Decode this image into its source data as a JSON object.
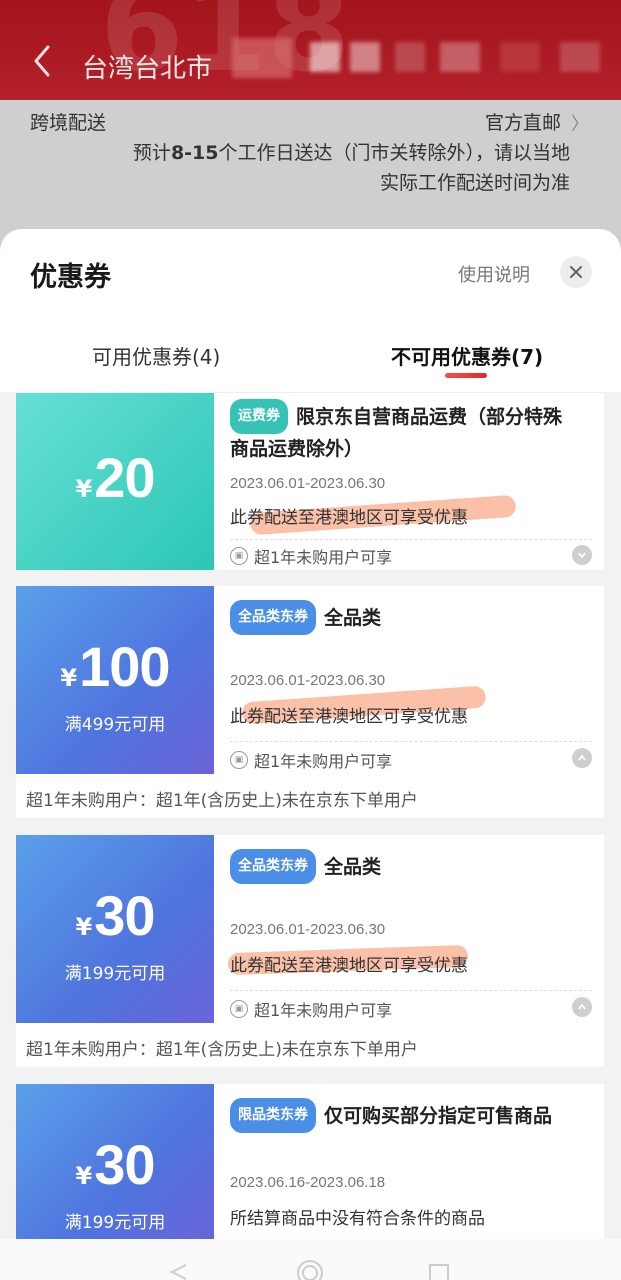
{
  "header": {
    "location": "台湾台北市"
  },
  "shipping": {
    "label": "跨境配送",
    "official": "官方直邮",
    "desc_prefix": "预计",
    "desc_days": "8-15",
    "desc_suffix": "个工作日送达（门市关转除外），请以当地实际工作配送时间为准"
  },
  "sheet": {
    "title": "优惠券",
    "help": "使用说明",
    "tabs": {
      "available": "可用优惠券(4)",
      "unavailable": "不可用优惠券(7)"
    }
  },
  "coupons": [
    {
      "color": "teal",
      "currency": "¥",
      "amount": "20",
      "threshold": "",
      "badge": "运费券",
      "title": "限京东自营商品运费（部分特殊商品运费除外）",
      "date": "2023.06.01-2023.06.30",
      "note": "此券配送至港澳地区可享受优惠",
      "condition": "超1年未购用户可享",
      "expanded": ""
    },
    {
      "color": "blue",
      "currency": "¥",
      "amount": "100",
      "threshold": "满499元可用",
      "badge": "全品类东券",
      "title": "全品类",
      "date": "2023.06.01-2023.06.30",
      "note": "此券配送至港澳地区可享受优惠",
      "condition": "超1年未购用户可享",
      "expanded": "超1年未购用户：超1年(含历史上)未在京东下单用户"
    },
    {
      "color": "blue",
      "currency": "¥",
      "amount": "30",
      "threshold": "满199元可用",
      "badge": "全品类东券",
      "title": "全品类",
      "date": "2023.06.01-2023.06.30",
      "note": "此券配送至港澳地区可享受优惠",
      "condition": "超1年未购用户可享",
      "expanded": "超1年未购用户：超1年(含历史上)未在京东下单用户"
    },
    {
      "color": "blue",
      "currency": "¥",
      "amount": "30",
      "threshold": "满199元可用",
      "badge": "限品类东券",
      "title": "仅可购买部分指定可售商品",
      "date": "2023.06.16-2023.06.18",
      "note": "所结算商品中没有符合条件的商品",
      "condition": "",
      "expanded": ""
    }
  ],
  "colors": {
    "accent_red": "#e02a27",
    "teal": "#2cc6b4",
    "blue": "#4f74de",
    "highlight": "#f6966e"
  }
}
